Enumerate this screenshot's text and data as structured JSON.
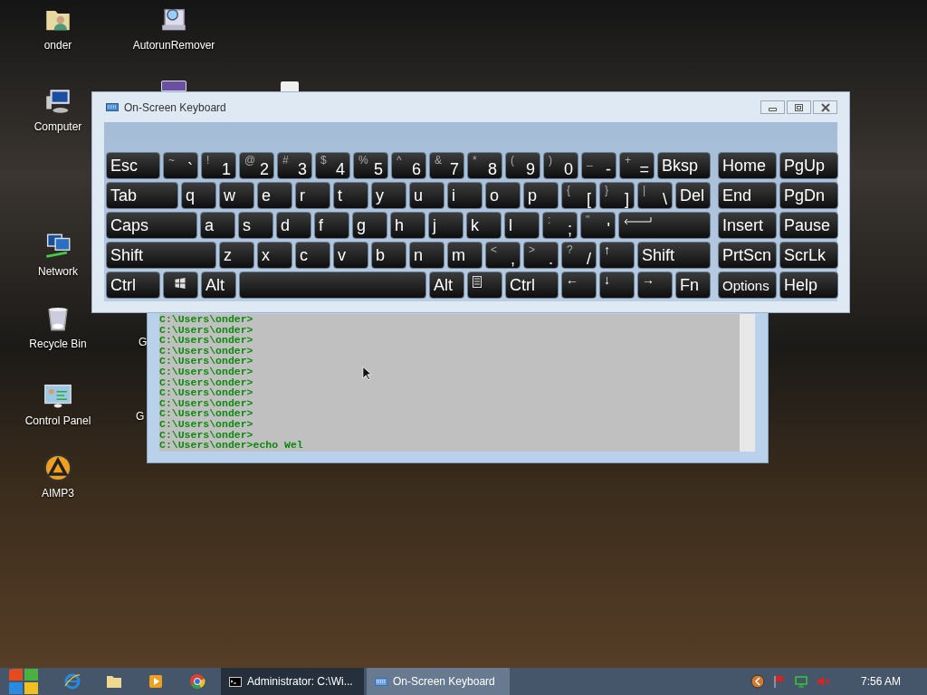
{
  "desktop_icons": [
    {
      "label": "onder"
    },
    {
      "label": "Computer"
    },
    {
      "label": "Network"
    },
    {
      "label": "Recycle Bin"
    },
    {
      "label": "Control Panel"
    },
    {
      "label": "AIMP3"
    },
    {
      "label": "AutorunRemover"
    },
    {
      "label": "G"
    },
    {
      "label": "G"
    }
  ],
  "console": {
    "lines": [
      "C:\\Users\\onder>",
      "C:\\Users\\onder>",
      "C:\\Users\\onder>",
      "C:\\Users\\onder>",
      "C:\\Users\\onder>",
      "C:\\Users\\onder>",
      "C:\\Users\\onder>",
      "C:\\Users\\onder>",
      "C:\\Users\\onder>",
      "C:\\Users\\onder>",
      "C:\\Users\\onder>",
      "C:\\Users\\onder>",
      "C:\\Users\\onder>echo Wel"
    ]
  },
  "keyboard": {
    "title": "On-Screen Keyboard",
    "main_rows": [
      [
        {
          "kind": "text",
          "label": "Esc"
        },
        {
          "kind": "dual",
          "shifted": "~",
          "label": "`"
        },
        {
          "kind": "dual",
          "shifted": "!",
          "label": "1"
        },
        {
          "kind": "dual",
          "shifted": "@",
          "label": "2"
        },
        {
          "kind": "dual",
          "shifted": "#",
          "label": "3"
        },
        {
          "kind": "dual",
          "shifted": "$",
          "label": "4"
        },
        {
          "kind": "dual",
          "shifted": "%",
          "label": "5"
        },
        {
          "kind": "dual",
          "shifted": "^",
          "label": "6"
        },
        {
          "kind": "dual",
          "shifted": "&",
          "label": "7"
        },
        {
          "kind": "dual",
          "shifted": "*",
          "label": "8"
        },
        {
          "kind": "dual",
          "shifted": "(",
          "label": "9"
        },
        {
          "kind": "dual",
          "shifted": ")",
          "label": "0"
        },
        {
          "kind": "dual",
          "shifted": "_",
          "label": "-"
        },
        {
          "kind": "dual",
          "shifted": "+",
          "label": "="
        },
        {
          "kind": "text",
          "label": "Bksp"
        }
      ],
      [
        {
          "kind": "text",
          "label": "Tab"
        },
        {
          "kind": "text",
          "label": "q"
        },
        {
          "kind": "text",
          "label": "w"
        },
        {
          "kind": "text",
          "label": "e"
        },
        {
          "kind": "text",
          "label": "r"
        },
        {
          "kind": "text",
          "label": "t"
        },
        {
          "kind": "text",
          "label": "y"
        },
        {
          "kind": "text",
          "label": "u"
        },
        {
          "kind": "text",
          "label": "i"
        },
        {
          "kind": "text",
          "label": "o"
        },
        {
          "kind": "text",
          "label": "p"
        },
        {
          "kind": "dual",
          "shifted": "{",
          "label": "["
        },
        {
          "kind": "dual",
          "shifted": "}",
          "label": "]"
        },
        {
          "kind": "dual",
          "shifted": "|",
          "label": "\\"
        },
        {
          "kind": "text",
          "label": "Del"
        }
      ],
      [
        {
          "kind": "text",
          "label": "Caps"
        },
        {
          "kind": "text",
          "label": "a"
        },
        {
          "kind": "text",
          "label": "s"
        },
        {
          "kind": "text",
          "label": "d"
        },
        {
          "kind": "text",
          "label": "f"
        },
        {
          "kind": "text",
          "label": "g"
        },
        {
          "kind": "text",
          "label": "h"
        },
        {
          "kind": "text",
          "label": "j"
        },
        {
          "kind": "text",
          "label": "k"
        },
        {
          "kind": "text",
          "label": "l"
        },
        {
          "kind": "dual",
          "shifted": ":",
          "label": ";"
        },
        {
          "kind": "dual",
          "shifted": "\"",
          "label": "'"
        },
        {
          "kind": "enter"
        }
      ],
      [
        {
          "kind": "text",
          "label": "Shift"
        },
        {
          "kind": "text",
          "label": "z"
        },
        {
          "kind": "text",
          "label": "x"
        },
        {
          "kind": "text",
          "label": "c"
        },
        {
          "kind": "text",
          "label": "v"
        },
        {
          "kind": "text",
          "label": "b"
        },
        {
          "kind": "text",
          "label": "n"
        },
        {
          "kind": "text",
          "label": "m"
        },
        {
          "kind": "dual",
          "shifted": "<",
          "label": ","
        },
        {
          "kind": "dual",
          "shifted": ">",
          "label": "."
        },
        {
          "kind": "dual",
          "shifted": "?",
          "label": "/"
        },
        {
          "kind": "arrow",
          "label": "↑"
        },
        {
          "kind": "text",
          "label": "Shift"
        }
      ],
      [
        {
          "kind": "text",
          "label": "Ctrl"
        },
        {
          "kind": "windows"
        },
        {
          "kind": "text",
          "label": "Alt"
        },
        {
          "kind": "space"
        },
        {
          "kind": "text",
          "label": "Alt"
        },
        {
          "kind": "menu"
        },
        {
          "kind": "text",
          "label": "Ctrl"
        },
        {
          "kind": "arrow",
          "label": "←"
        },
        {
          "kind": "arrow",
          "label": "↓"
        },
        {
          "kind": "arrow",
          "label": "→"
        },
        {
          "kind": "text",
          "label": "Fn"
        }
      ]
    ],
    "nav_rows": [
      [
        {
          "kind": "text",
          "label": "Home"
        },
        {
          "kind": "text",
          "label": "PgUp"
        }
      ],
      [
        {
          "kind": "text",
          "label": "End"
        },
        {
          "kind": "text",
          "label": "PgDn"
        }
      ],
      [
        {
          "kind": "text",
          "label": "Insert"
        },
        {
          "kind": "text",
          "label": "Pause"
        }
      ],
      [
        {
          "kind": "text",
          "label": "PrtScn"
        },
        {
          "kind": "text",
          "label": "ScrLk"
        }
      ],
      [
        {
          "kind": "small",
          "label": "Options"
        },
        {
          "kind": "text",
          "label": "Help"
        }
      ]
    ]
  },
  "taskbar": {
    "tasks": [
      {
        "label": "Administrator: C:\\Wi...",
        "selected": false
      },
      {
        "label": "On-Screen Keyboard",
        "selected": true
      }
    ],
    "clock": "7:56 AM"
  }
}
